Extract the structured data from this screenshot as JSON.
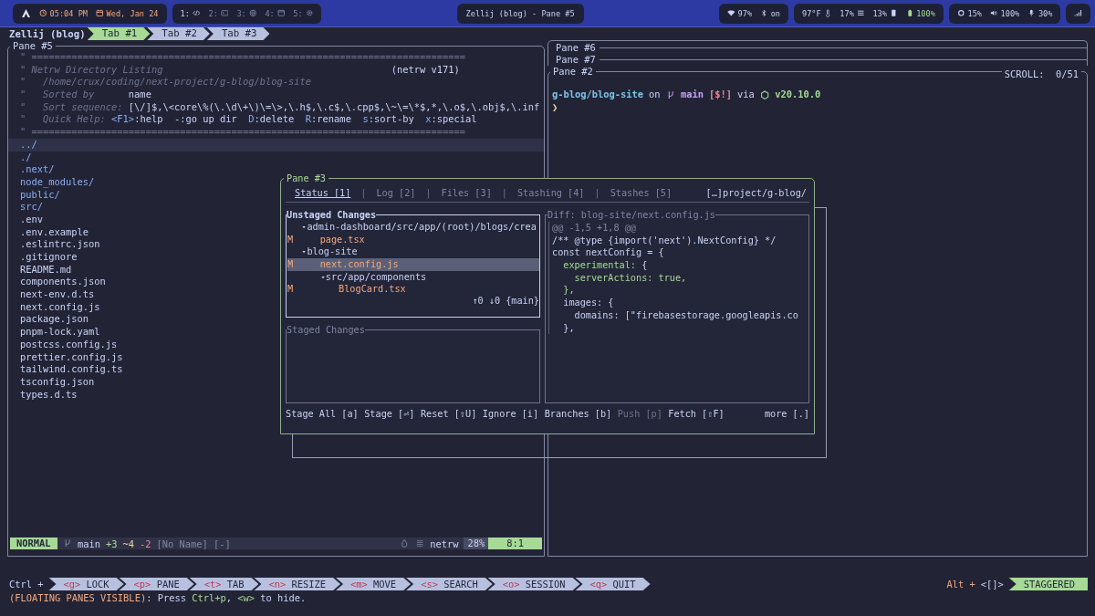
{
  "top_bar": {
    "clock": {
      "time": "05:04 PM",
      "date": "Wed, Jan 24"
    },
    "workspaces": [
      {
        "label": "1:",
        "kind": "code",
        "active": true
      },
      {
        "label": "2:",
        "kind": "terminal",
        "active": false
      },
      {
        "label": "3:",
        "kind": "globe",
        "active": false
      },
      {
        "label": "4:",
        "kind": "window",
        "active": false
      },
      {
        "label": "5:",
        "kind": "gear",
        "active": false
      }
    ],
    "window_title": "Zellij (blog) - Pane #5",
    "status_groups": [
      [
        {
          "kind": "wifi",
          "text": "97%"
        },
        {
          "kind": "bluetooth",
          "text": "on"
        }
      ],
      [
        {
          "kind": "temperature",
          "text": "97°F"
        },
        {
          "kind": "cpu",
          "text": "17%"
        },
        {
          "kind": "memory",
          "text": "13%"
        },
        {
          "kind": "battery",
          "text": "100%"
        }
      ],
      [
        {
          "kind": "brightness",
          "text": "15%"
        },
        {
          "kind": "volume",
          "text": "100%"
        },
        {
          "kind": "microphone",
          "text": "30%"
        }
      ]
    ]
  },
  "tab_bar": {
    "session": "Zellij (blog)",
    "tabs": [
      {
        "label": "Tab #1",
        "selected": true
      },
      {
        "label": "Tab #2",
        "selected": false
      },
      {
        "label": "Tab #3",
        "selected": false
      }
    ]
  },
  "left_pane": {
    "title": "Pane #5",
    "header_lines": [
      [
        {
          "text": "\" ============================================================================",
          "kind": "comment"
        }
      ],
      [
        {
          "text": "\" Netrw Directory Listing                                        ",
          "kind": "comment"
        },
        {
          "text": "(netrw v171)",
          "kind": "value"
        }
      ],
      [
        {
          "text": "\"   /home/crux/coding/next-project/g-blog/blog-site",
          "kind": "comment"
        }
      ],
      [
        {
          "text": "\"   Sorted by      ",
          "kind": "comment"
        },
        {
          "text": "name",
          "kind": "value"
        }
      ],
      [
        {
          "text": "\"   Sort sequence: ",
          "kind": "comment"
        },
        {
          "text": "[\\/]$,\\<core\\%(\\.\\d\\+\\)\\=\\>,\\.h$,\\.c$,\\.cpp$,\\~\\=\\*$,*,\\.o$,\\.obj$,\\.inf",
          "kind": "value"
        }
      ],
      [
        {
          "text": "\"   Quick Help: ",
          "kind": "comment"
        },
        {
          "text": "<F1>",
          "kind": "key"
        },
        {
          "text": ":help  -:go up dir  ",
          "kind": "value"
        },
        {
          "text": "D",
          "kind": "key"
        },
        {
          "text": ":delete  ",
          "kind": "value"
        },
        {
          "text": "R",
          "kind": "key"
        },
        {
          "text": ":rename  ",
          "kind": "value"
        },
        {
          "text": "s",
          "kind": "key"
        },
        {
          "text": ":sort-by  ",
          "kind": "value"
        },
        {
          "text": "x",
          "kind": "key"
        },
        {
          "text": ":special",
          "kind": "value"
        }
      ],
      [
        {
          "text": "\" ============================================================================",
          "kind": "comment"
        }
      ]
    ],
    "entries": [
      {
        "name": "../",
        "kind": "dir",
        "selected": true
      },
      {
        "name": "./",
        "kind": "dir",
        "selected": false
      },
      {
        "name": ".next/",
        "kind": "dir",
        "selected": false
      },
      {
        "name": "node_modules/",
        "kind": "dir",
        "selected": false
      },
      {
        "name": "public/",
        "kind": "dir",
        "selected": false
      },
      {
        "name": "src/",
        "kind": "dir",
        "selected": false
      },
      {
        "name": ".env",
        "kind": "file",
        "selected": false
      },
      {
        "name": ".env.example",
        "kind": "file",
        "selected": false
      },
      {
        "name": ".eslintrc.json",
        "kind": "file",
        "selected": false
      },
      {
        "name": ".gitignore",
        "kind": "file",
        "selected": false
      },
      {
        "name": "README.md",
        "kind": "file",
        "selected": false
      },
      {
        "name": "components.json",
        "kind": "file",
        "selected": false
      },
      {
        "name": "next-env.d.ts",
        "kind": "file",
        "selected": false
      },
      {
        "name": "next.config.js",
        "kind": "file",
        "selected": false
      },
      {
        "name": "package.json",
        "kind": "file",
        "selected": false
      },
      {
        "name": "pnpm-lock.yaml",
        "kind": "file",
        "selected": false
      },
      {
        "name": "postcss.config.js",
        "kind": "file",
        "selected": false
      },
      {
        "name": "prettier.config.js",
        "kind": "file",
        "selected": false
      },
      {
        "name": "tailwind.config.ts",
        "kind": "file",
        "selected": false
      },
      {
        "name": "tsconfig.json",
        "kind": "file",
        "selected": false
      },
      {
        "name": "types.d.ts",
        "kind": "file",
        "selected": false
      }
    ],
    "status_line": {
      "mode": "NORMAL",
      "branch": "main",
      "added": "+3",
      "changed": "~4",
      "removed": "-2",
      "buffer": "[No Name] [-]",
      "filetype": "netrw",
      "percent": "28%",
      "position": "8:1"
    }
  },
  "right_column": {
    "stacked_panes": [
      {
        "title": "Pane #6"
      },
      {
        "title": "Pane #7"
      }
    ],
    "pane": {
      "title": "Pane #2",
      "scroll": "SCROLL:  0/51",
      "prompt": {
        "directory": "g-blog/blog-site",
        "on": "on",
        "branch": "main",
        "status": "[$!]",
        "via": "via",
        "runtime": "v20.10.0",
        "symbol": "❯"
      }
    }
  },
  "floating_pane": {
    "title": "Pane #3",
    "tabs": {
      "separator": "|",
      "items": [
        {
          "label": "Status [1]",
          "selected": true
        },
        {
          "label": "Log [2]",
          "selected": false
        },
        {
          "label": "Files [3]",
          "selected": false
        },
        {
          "label": "Stashing [4]",
          "selected": false
        },
        {
          "label": "Stashes [5]",
          "selected": false
        }
      ]
    },
    "repo": "[…]project/g-blog/",
    "unstaged": {
      "title": "Unstaged Changes",
      "footer": "↑0 ↓0 {main}",
      "tree": [
        {
          "name": "admin-dashboard/src/app/(root)/blogs/crea",
          "expanded": true,
          "selected": false,
          "children": [
            {
              "name": "page.tsx",
              "status": "M",
              "selected": false
            }
          ]
        },
        {
          "name": "blog-site",
          "expanded": true,
          "selected": false,
          "children": [
            {
              "name": "next.config.js",
              "status": "M",
              "selected": true
            },
            {
              "name": "src/app/components",
              "expanded": true,
              "selected": false,
              "children": [
                {
                  "name": "BlogCard.tsx",
                  "status": "M",
                  "selected": false
                }
              ]
            }
          ]
        }
      ]
    },
    "staged": {
      "title": "Staged Changes"
    },
    "diff": {
      "title": "Diff: blog-site/next.config.js",
      "lines": [
        [
          {
            "text": "@@ -1,5 +1,8 @@",
            "kind": "hunk"
          }
        ],
        [
          {
            "text": "/** @type {import('next').NextConfig} */",
            "kind": "code"
          }
        ],
        [
          {
            "text": "const nextConfig = {",
            "kind": "code"
          }
        ],
        [
          {
            "text": "  experimental:",
            "kind": "key"
          },
          {
            "text": " {",
            "kind": "code"
          }
        ],
        [
          {
            "text": "    serverActions: true,",
            "kind": "key"
          }
        ],
        [
          {
            "text": "  },",
            "kind": "key"
          }
        ],
        [
          {
            "text": "  images: {",
            "kind": "code"
          }
        ],
        [
          {
            "text": "    domains: [\"firebasestorage.googleapis.co",
            "kind": "code"
          }
        ],
        [
          {
            "text": "  },",
            "kind": "code"
          }
        ]
      ]
    },
    "keybindings": [
      {
        "text": "Stage All [a]",
        "disabled": false
      },
      {
        "text": "Stage [⏎]",
        "disabled": false
      },
      {
        "text": "Reset [⇧U]",
        "disabled": false
      },
      {
        "text": "Ignore [i]",
        "disabled": false
      },
      {
        "text": "Branches [b]",
        "disabled": false
      },
      {
        "text": "Push [p]",
        "disabled": true
      },
      {
        "text": "Fetch [⇧F]",
        "disabled": false
      },
      {
        "text": "more [.]",
        "disabled": false
      }
    ]
  },
  "bottom_bar": {
    "modifier": "Ctrl +",
    "keys": [
      {
        "key": "<g>",
        "action": "LOCK"
      },
      {
        "key": "<p>",
        "action": "PANE"
      },
      {
        "key": "<t>",
        "action": "TAB"
      },
      {
        "key": "<n>",
        "action": "RESIZE"
      },
      {
        "key": "<m>",
        "action": "MOVE"
      },
      {
        "key": "<s>",
        "action": "SEARCH"
      },
      {
        "key": "<o>",
        "action": "SESSION"
      },
      {
        "key": "<q>",
        "action": "QUIT"
      }
    ],
    "alt_modifier": "Alt +",
    "alt_keys": "<[]>",
    "layout": "STAGGERED",
    "hint": [
      {
        "text": "(FLOATING PANES VISIBLE)",
        "kind": "warn"
      },
      {
        "text": ": Press ",
        "kind": "plain"
      },
      {
        "text": "Ctrl+p",
        "kind": "key"
      },
      {
        "text": ", ",
        "kind": "plain"
      },
      {
        "text": "<w>",
        "kind": "key"
      },
      {
        "text": " to hide.",
        "kind": "plain"
      }
    ]
  }
}
